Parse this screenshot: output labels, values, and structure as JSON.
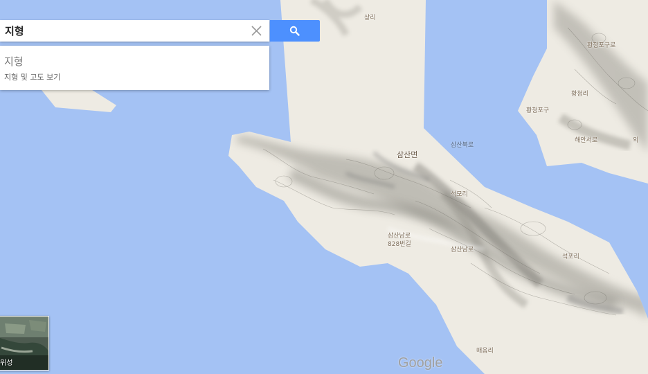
{
  "search": {
    "value": "지형"
  },
  "suggestion": {
    "title": "지형",
    "subtitle": "지형 및 고도 보기"
  },
  "labels": {
    "sangri": "상리",
    "hwangcheongpogu_ro": "황청포구로",
    "hwangcheongri": "황청리",
    "hwangcheongpogu": "황청포구",
    "haean_seoro": "해안서로",
    "oe": "외",
    "samsan_myeon": "삼산면",
    "samsan_bukro": "삼산북로",
    "seokmori": "석모리",
    "samsan_namro": "삼산남로",
    "address_828": "828번길",
    "samsan_namro_2": "삼산남로",
    "seokpori": "석포리",
    "maeeumri": "매음리"
  },
  "map_layers": {
    "satellite_label": "위성"
  },
  "logo": {
    "text": "Google"
  },
  "colors": {
    "water": "#a4c2f4",
    "land": "#eeebe3",
    "search_button": "#4d90fe"
  }
}
